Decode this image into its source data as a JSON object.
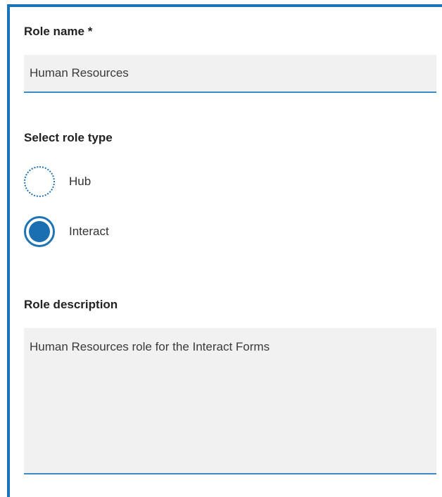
{
  "form": {
    "role_name": {
      "label": "Role name *",
      "value": "Human Resources"
    },
    "role_type": {
      "label": "Select role type",
      "options": [
        {
          "label": "Hub",
          "selected": false
        },
        {
          "label": "Interact",
          "selected": true
        }
      ]
    },
    "role_description": {
      "label": "Role description",
      "value": "Human Resources role for the Interact Forms"
    }
  },
  "colors": {
    "accent": "#1a73b8",
    "field_background": "#f1f1f1"
  }
}
